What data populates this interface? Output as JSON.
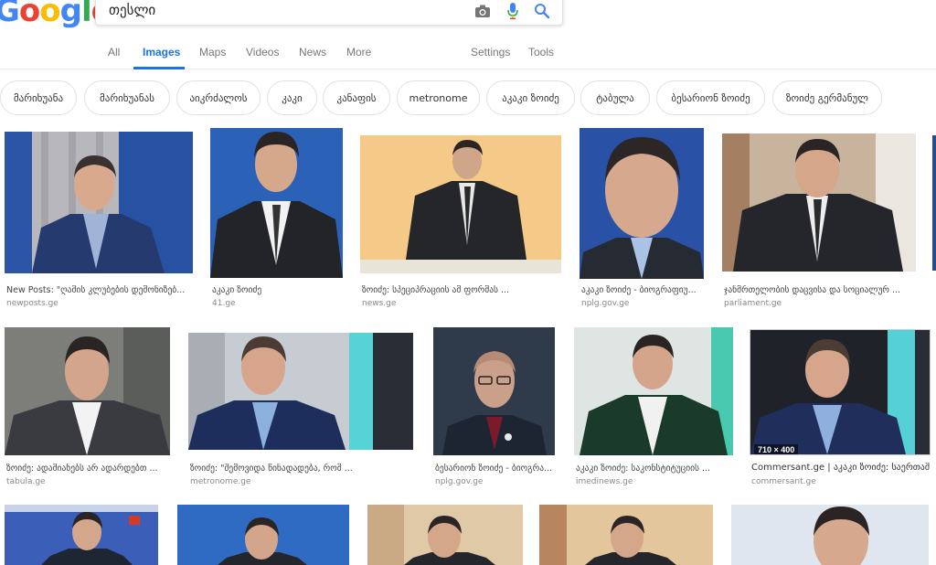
{
  "header": {
    "logo_text": "Google",
    "search": {
      "value": "თესლი",
      "placeholder": ""
    }
  },
  "tabs": [
    {
      "label": "All"
    },
    {
      "label": "Images"
    },
    {
      "label": "Maps"
    },
    {
      "label": "Videos"
    },
    {
      "label": "News"
    },
    {
      "label": "More"
    },
    {
      "label": "Settings"
    },
    {
      "label": "Tools"
    }
  ],
  "chips": [
    "მარიხუანა",
    "მარიხუანას",
    "აიკრძალოს",
    "კაკი",
    "კანაფის",
    "metronome",
    "აკაკი ზოიძე",
    "ტაბულა",
    "ბესარიონ ზოიძე",
    "ზოიძე გერმანულ"
  ],
  "results": [
    {
      "title": "New Posts: \"ღამის კლუბების დემონიზებ...",
      "domain": "newposts.ge"
    },
    {
      "title": "აკაკი ზოიძე",
      "domain": "41.ge"
    },
    {
      "title": "ზოიძე: სპეციპრაციის ამ ფორმას ...",
      "domain": "news.ge"
    },
    {
      "title": "აკაკი ზოიძე - ბიოგრაფიუ...",
      "domain": "nplg.gov.ge"
    },
    {
      "title": "ჯანმრთელობის დაცვისა და სოციალურ ...",
      "domain": "parliament.ge"
    },
    {
      "title": "ზოიძე: ადამიანებს არ ადარდებთ ...",
      "domain": "tabula.ge"
    },
    {
      "title": "ზოიძე: \"შემოვიდა წინადადება, რომ ...",
      "domain": "metronome.ge"
    },
    {
      "title": "ბესარიონ ზოიძე - ბიოგრა...",
      "domain": "nplg.gov.ge"
    },
    {
      "title": "აკაკი ზოიძე: საკონსტიტუციის ...",
      "domain": "imedinews.ge"
    },
    {
      "title": "Commersant.ge | აკაკი ზოიძე: საერთაშ...",
      "domain": "commersant.ge",
      "dims": "710 × 400"
    }
  ],
  "colors": {
    "accent": "#1a73e8",
    "logo_blue": "#4285f4",
    "logo_red": "#ea4335",
    "logo_yellow": "#fbbc05",
    "logo_green": "#34a853"
  },
  "icons": [
    "camera-icon",
    "microphone-icon",
    "search-icon"
  ]
}
